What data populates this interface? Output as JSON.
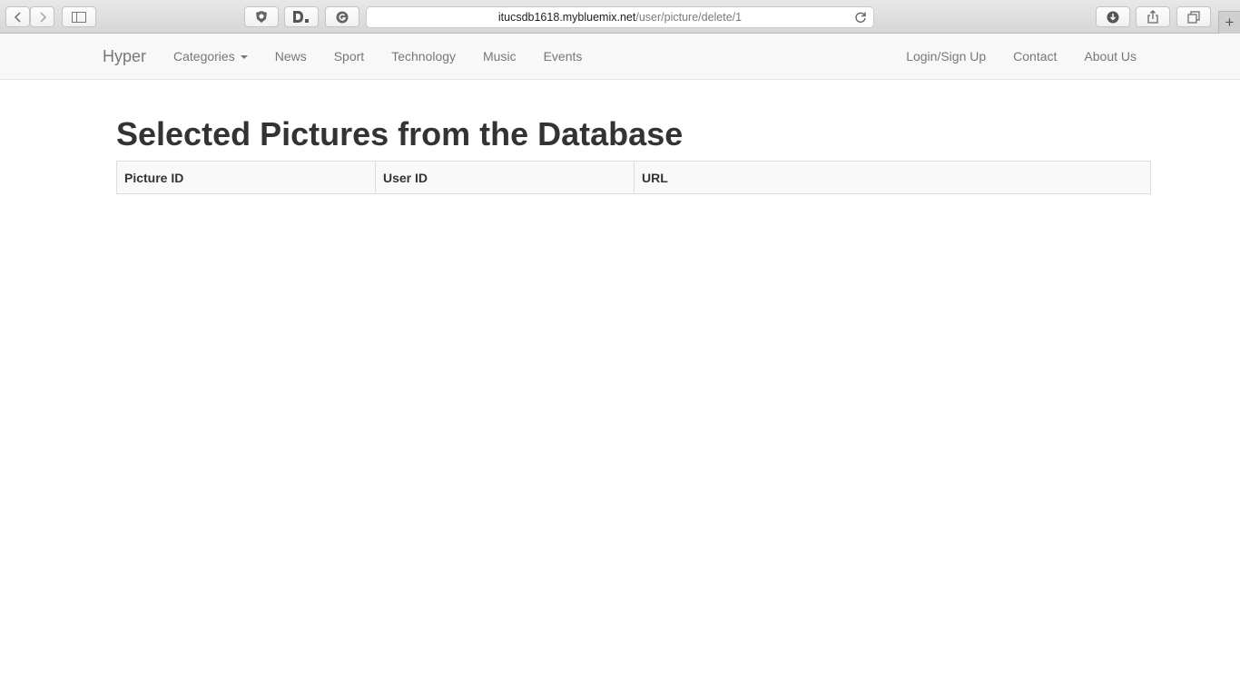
{
  "browser": {
    "address_host": "itucsdb1618.mybluemix.net",
    "address_path": "/user/picture/delete/1",
    "new_tab_glyph": "+"
  },
  "navbar": {
    "brand": "Hyper",
    "left_items": [
      {
        "label": "Categories",
        "dropdown": true
      },
      {
        "label": "News"
      },
      {
        "label": "Sport"
      },
      {
        "label": "Technology"
      },
      {
        "label": "Music"
      },
      {
        "label": "Events"
      }
    ],
    "right_items": [
      {
        "label": "Login/Sign Up"
      },
      {
        "label": "Contact"
      },
      {
        "label": "About Us"
      }
    ]
  },
  "page": {
    "title": "Selected Pictures from the Database",
    "table": {
      "columns": [
        "Picture ID",
        "User ID",
        "URL"
      ],
      "rows": []
    }
  }
}
